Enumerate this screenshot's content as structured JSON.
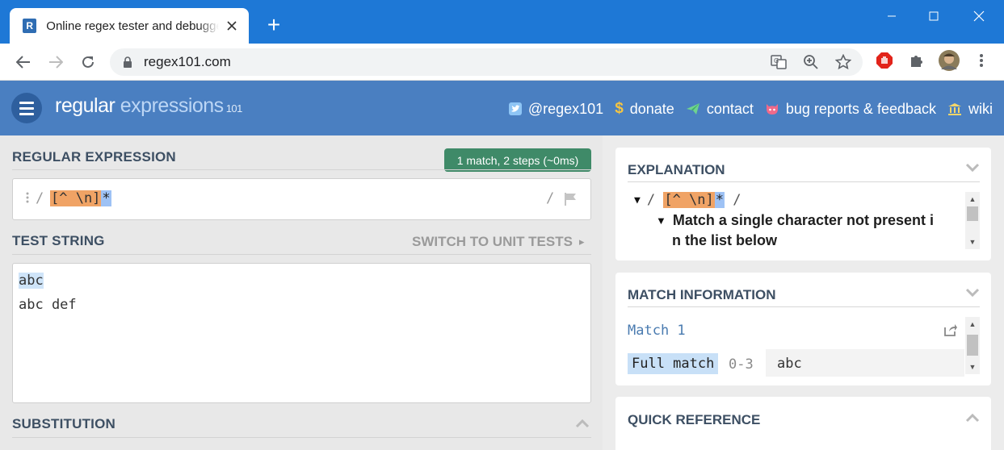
{
  "browser": {
    "tab_title": "Online regex tester and debugger: PHP, PCRE, Python, Golang and JavaScript",
    "favicon_letter": "R",
    "new_tab_label": "+",
    "url": "regex101.com"
  },
  "app": {
    "logo_part1": "regular",
    "logo_part2": "expressions",
    "logo_part3": "101",
    "nav": [
      {
        "icon": "twitter-icon",
        "label": "@regex101"
      },
      {
        "icon": "dollar-icon",
        "label": "donate"
      },
      {
        "icon": "paper-plane-icon",
        "label": "contact"
      },
      {
        "icon": "github-icon",
        "label": "bug reports & feedback"
      },
      {
        "icon": "bank-icon",
        "label": "wiki"
      }
    ]
  },
  "editor": {
    "regex_heading": "REGULAR EXPRESSION",
    "match_badge": "1 match, 2 steps (~0ms)",
    "delimiter": "/",
    "regex_class": "[^ \\n]",
    "regex_quant": "*",
    "test_heading": "TEST STRING",
    "switch_label": "SWITCH TO UNIT TESTS",
    "switch_arrow": "▸",
    "test_lines": [
      "abc",
      "abc def"
    ],
    "substitution_heading": "SUBSTITUTION"
  },
  "explanation": {
    "heading": "EXPLANATION",
    "tri1": "▼",
    "tri2": "▼",
    "line1_prefix": "/",
    "line1_suffix": "/",
    "regex_class": "[^ \\n]",
    "regex_quant": "*",
    "line2": "Match a single character not present i",
    "line3": "n the list below"
  },
  "match_info": {
    "heading": "MATCH INFORMATION",
    "match_title": "Match 1",
    "full_match_label": "Full match",
    "range": "0-3",
    "value": "abc"
  },
  "quick_reference": {
    "heading": "QUICK REFERENCE"
  },
  "colors": {
    "browser_blue": "#1e78d6",
    "app_header": "#4a7fc1",
    "badge_green": "#3f8a68",
    "char_class": "#f0a365",
    "quantifier": "#9ec2f5",
    "match_highlight": "#cfe4f8"
  }
}
